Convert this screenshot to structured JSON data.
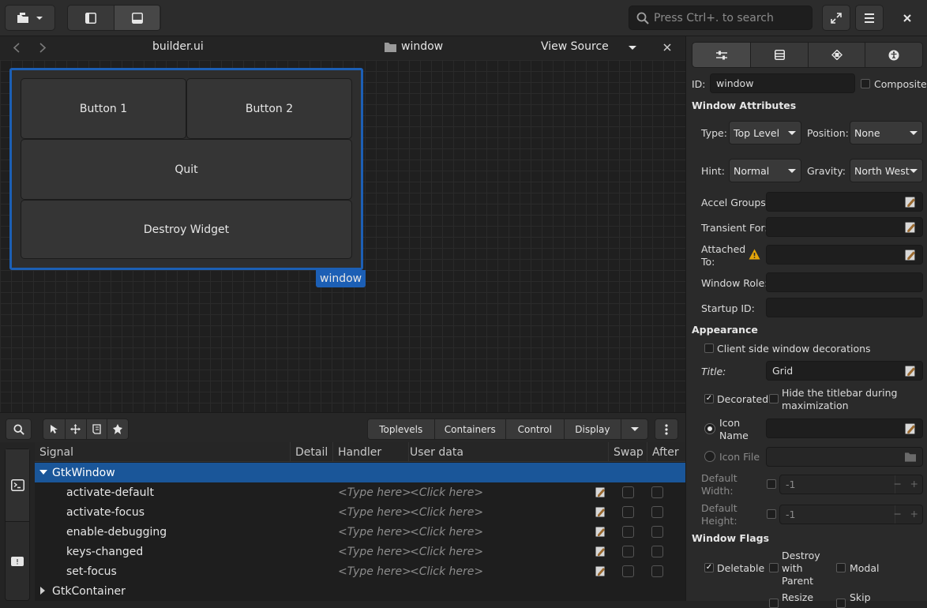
{
  "header": {
    "search_placeholder": "Press Ctrl+. to search"
  },
  "tabbar": {
    "file_name": "builder.ui",
    "object_name": "window",
    "view_source": "View Source"
  },
  "canvas": {
    "buttons": [
      "Button 1",
      "Button 2",
      "Quit",
      "Destroy Widget"
    ],
    "selection_label": "window"
  },
  "palette": {
    "groups": [
      "Toplevels",
      "Containers",
      "Control",
      "Display"
    ]
  },
  "signals": {
    "columns": [
      "Signal",
      "Detail",
      "Handler",
      "User data",
      "Swap",
      "After"
    ],
    "parent": "GtkWindow",
    "rows": [
      {
        "name": "activate-default",
        "handler": "<Type here>",
        "userdata": "<Click here>"
      },
      {
        "name": "activate-focus",
        "handler": "<Type here>",
        "userdata": "<Click here>"
      },
      {
        "name": "enable-debugging",
        "handler": "<Type here>",
        "userdata": "<Click here>"
      },
      {
        "name": "keys-changed",
        "handler": "<Type here>",
        "userdata": "<Click here>"
      },
      {
        "name": "set-focus",
        "handler": "<Type here>",
        "userdata": "<Click here>"
      }
    ],
    "next_parent": "GtkContainer"
  },
  "properties": {
    "id_label": "ID:",
    "id_value": "window",
    "composite_label": "Composite",
    "window_attributes": "Window Attributes",
    "type_label": "Type:",
    "type_value": "Top Level",
    "position_label": "Position:",
    "position_value": "None",
    "hint_label": "Hint:",
    "hint_value": "Normal",
    "gravity_label": "Gravity:",
    "gravity_value": "North West",
    "accel_groups_label": "Accel Groups:",
    "transient_for_label": "Transient For:",
    "attached_to_label_1": "Attached",
    "attached_to_label_2": "To:",
    "window_role_label": "Window Role:",
    "startup_id_label": "Startup ID:",
    "appearance": "Appearance",
    "client_side_label": "Client side window decorations",
    "title_label": "Title:",
    "title_value": "Grid",
    "decorated_label": "Decorated",
    "hide_titlebar_label_1": "Hide the titlebar during",
    "hide_titlebar_label_2": "maximization",
    "icon_name_label_1": "Icon",
    "icon_name_label_2": "Name",
    "icon_file_label": "Icon File",
    "default_width_label_1": "Default",
    "default_width_label_2": "Width:",
    "default_width_value": "-1",
    "default_height_label_1": "Default",
    "default_height_label_2": "Height:",
    "default_height_value": "-1",
    "window_flags": "Window Flags",
    "deletable_label": "Deletable",
    "destroy_parent_label_1": "Destroy",
    "destroy_parent_label_2": "with",
    "destroy_parent_label_3": "Parent",
    "modal_label": "Modal",
    "resize_label": "Resize",
    "skip_label": "Skip"
  },
  "colors": {
    "accent": "#1c5fb5",
    "selection_bg": "#1a5699",
    "warning": "#e5a50a"
  }
}
